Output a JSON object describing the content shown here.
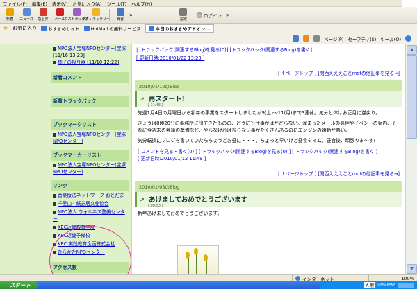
{
  "menu": [
    "ファイル(F)",
    "編集(E)",
    "表示(V)",
    "お気に入り(A)",
    "ツール(T)",
    "ヘルプ(H)"
  ],
  "toolbar": {
    "buttons": [
      "新着",
      "ニュース",
      "急上昇",
      "メール",
      "ダストボックス",
      "ボタンギャラリー"
    ],
    "extra": [
      "辞書",
      "設定"
    ],
    "login": "ログイン",
    "more": "»"
  },
  "favorites": {
    "label": "お気に入り",
    "items": [
      "おすすめサイト",
      "HotMail の無料サービス",
      "本日のおすすめアドオン..."
    ]
  },
  "commandbar": [
    "ページ(P)",
    "セーフティ(S)",
    "ツール(O)"
  ],
  "sidebar": {
    "top_items": [
      {
        "text": "NPO法人宝塚NPOセンター(宝塚",
        "date": "[11/16 13:23]"
      },
      {
        "text": "柚子の搾り器",
        "date": "[11/10 12:22]"
      }
    ],
    "headers": {
      "comments": "新着コメント",
      "trackback": "新着トラックバック",
      "bookmark": "ブックマークリスト",
      "bookmark2": "ブックマーカーリスト",
      "links": "リンク",
      "access": "アクセス数"
    },
    "bookmark_items": [
      "NPO法人宝塚NPOセンター(宝塚NPOセンター)"
    ],
    "bookmark2_items": [
      "NPO法人宝塚NPOセンター(宝塚NPOセンター)"
    ],
    "links": [
      "音楽療法ネットワーク おとだま",
      "千里山・紙芝居文化協会",
      "NPO法人 ウォルネス整美センター",
      "KEC近畿教育学院",
      "KEC近畿予備校",
      "KEC 実践教育企画株式会社",
      "ひらかたNPOセンター"
    ]
  },
  "main": {
    "top_links": "| [トラックバック(関連するBlog)を見る(0)] [トラックバック(関連するBlog)を書く]",
    "top_update": "[ 更新日時:2010/01/22 13:23 ]",
    "nav_links": "[ ↑ページトップ ] [関西えええことmotの他記事を見る→]",
    "entries": [
      {
        "date": "2010/01/12のBlog",
        "title": "再スタート!",
        "time": "[ 11:48 ]",
        "body": [
          "先週1月4日の月曜日から新年の事業をスタートしましたが9(土)〜11(月)まで3連休。気分と体はお正月に逆戻り。",
          "きょうは8時20分に事務所に出てきたものの、どうにも仕事がはかどらない。溜まったメールの処理やイベントの案内、それに今週末の会議の準備など、やらなければならない事がたくさんあるのにエンジンの始動が悪い。",
          "気分転換にブログを書いていたらちょうどお昼に・・・。ちょっと早いけど昼食タイム。昼食後、頑張りま〜す!"
        ],
        "foot_links": "[ コメントを見る・書く(0) ] [ トラックバック(関連するBlog)を見る(0) ] [ トラックバック(関連するBlog)を書く ]",
        "update": "[ 更新日時:2010/01/12 11:49 ]"
      },
      {
        "date": "2010/01/05のBlog",
        "title": "あけましておめでとうございます",
        "time": "[ 08:53 ]",
        "body": [
          "新年あけましておめでとうございます。"
        ]
      }
    ]
  },
  "status": {
    "zone": "インターネット",
    "zoom": "100%"
  },
  "taskbar": {
    "start": "スタート",
    "ime": "A 般",
    "caps": "CAPS KANA"
  }
}
